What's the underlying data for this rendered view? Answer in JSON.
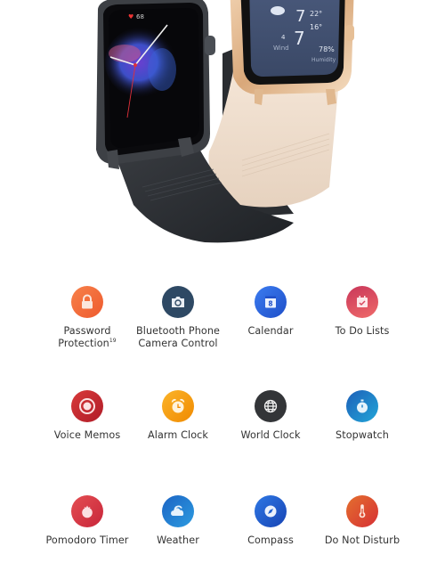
{
  "hero": {
    "product_image": "two smartwatches (black and beige bands)",
    "watch_black": {
      "heart_rate": "68",
      "face": "analog clock with smoke artwork"
    },
    "watch_beige": {
      "temp_high": "22°",
      "temp_low": "16°",
      "day": "7",
      "wind_value": "4",
      "wind_label": "Wind",
      "humidity_value": "78%",
      "humidity_label": "Humidity"
    }
  },
  "features": [
    {
      "label": "Password",
      "label2": "Protection",
      "sup": "19",
      "icon": "lock-icon",
      "color": "#F26A3A"
    },
    {
      "label": "Bluetooth Phone",
      "label2": "Camera Control",
      "icon": "camera-icon",
      "color": "#2F4A66"
    },
    {
      "label": "Calendar",
      "icon": "calendar-icon",
      "color": "#2563D8"
    },
    {
      "label": "To Do Lists",
      "icon": "todo-icon",
      "color": "#D9465E"
    },
    {
      "label": "Voice Memos",
      "icon": "record-icon",
      "color": "#C7262E"
    },
    {
      "label": "Alarm Clock",
      "icon": "alarm-clock-icon",
      "color": "#F59A0A"
    },
    {
      "label": "World Clock",
      "icon": "globe-icon",
      "color": "#333538"
    },
    {
      "label": "Stopwatch",
      "icon": "stopwatch-icon",
      "color": "#1A7FC8"
    },
    {
      "label": "Pomodoro Timer",
      "icon": "tomato-icon",
      "color": "#DD3B40"
    },
    {
      "label": "Weather",
      "icon": "cloud-icon",
      "color": "#1F7ED0"
    },
    {
      "label": "Compass",
      "icon": "compass-icon",
      "color": "#1F5FD0"
    },
    {
      "label": "Do Not Disturb",
      "icon": "thermometer-icon",
      "color": "#DD4A30"
    }
  ]
}
